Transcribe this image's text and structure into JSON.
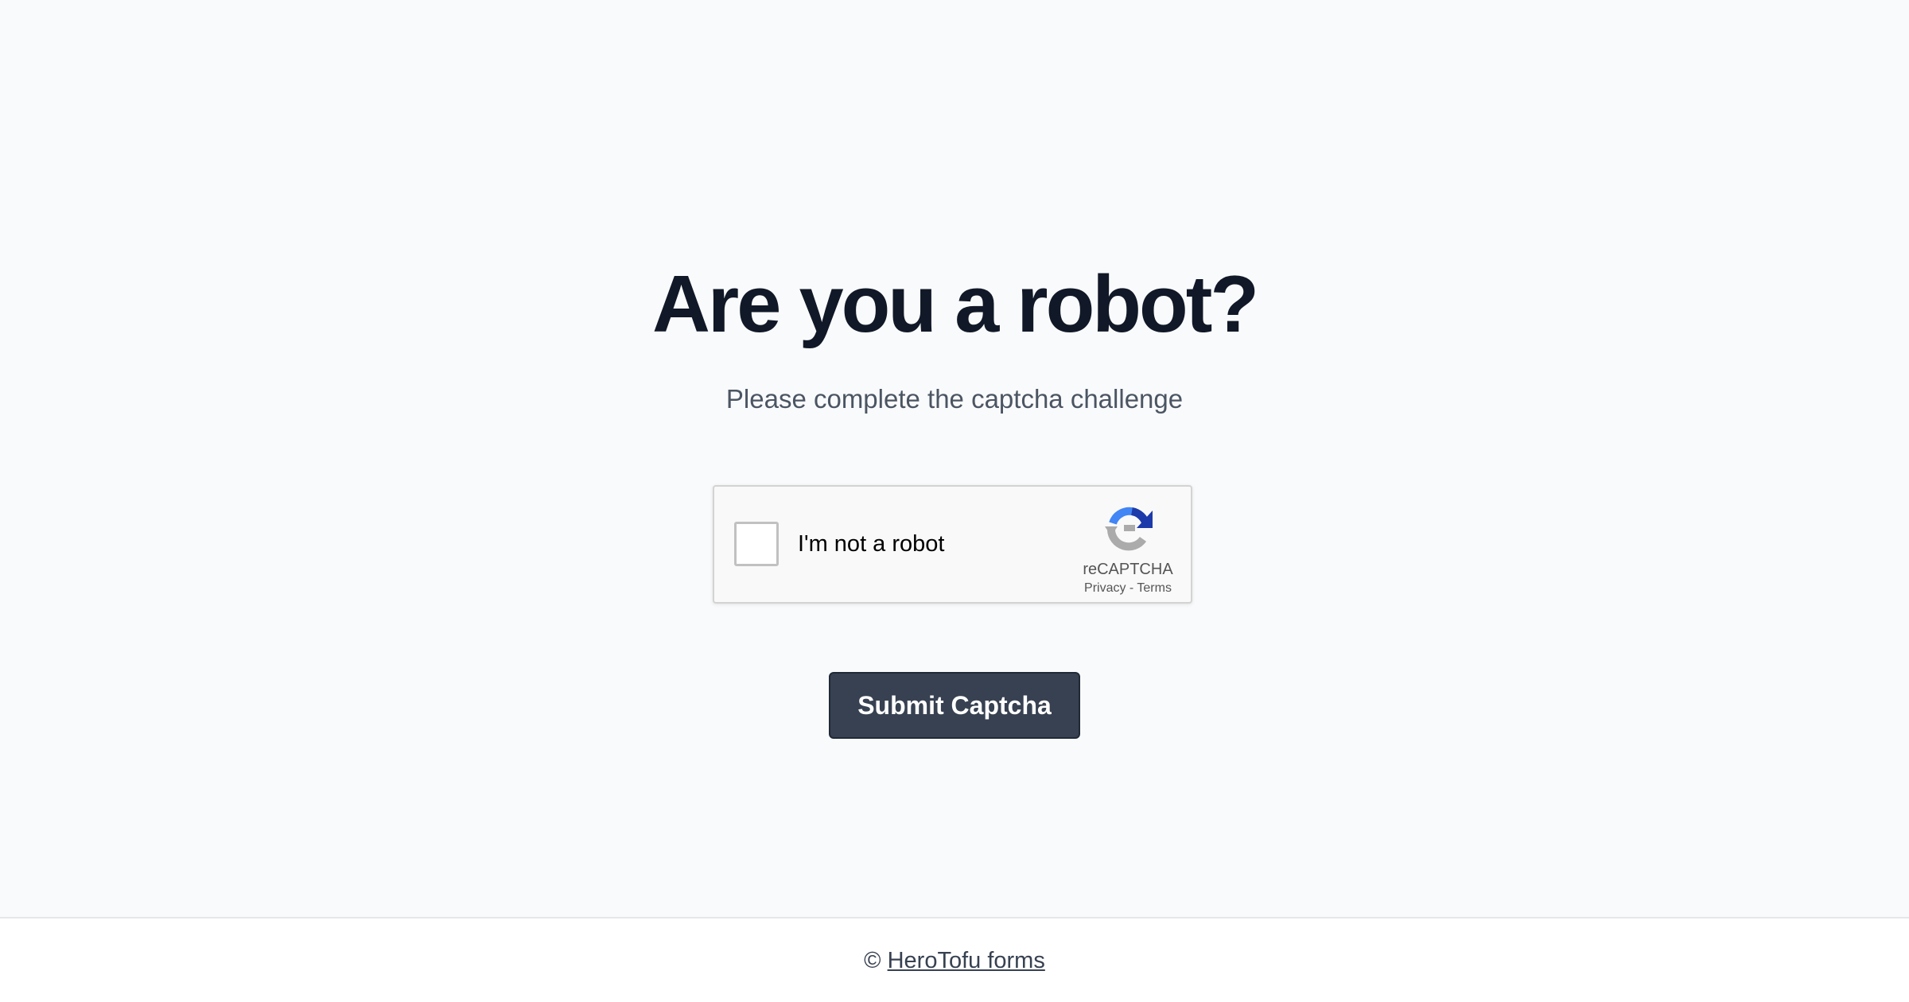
{
  "heading": {
    "title": "Are you a robot?",
    "subtitle": "Please complete the captcha challenge"
  },
  "recaptcha": {
    "checkbox_label": "I'm not a robot",
    "brand": "reCAPTCHA",
    "privacy_link": "Privacy",
    "separator": " - ",
    "terms_link": "Terms",
    "checked": false,
    "logo_icon": "recaptcha-logo-icon"
  },
  "form": {
    "submit_label": "Submit Captcha"
  },
  "footer": {
    "copyright_symbol": "©",
    "link_text": "HeroTofu forms"
  },
  "colors": {
    "background": "#f9fafb",
    "title": "#111827",
    "subtitle": "#4b5563",
    "button_bg": "#374151",
    "button_text": "#ffffff",
    "recaptcha_blue": "#1c3aa9",
    "recaptcha_light_blue": "#4285f4",
    "recaptcha_gray": "#ababab"
  }
}
